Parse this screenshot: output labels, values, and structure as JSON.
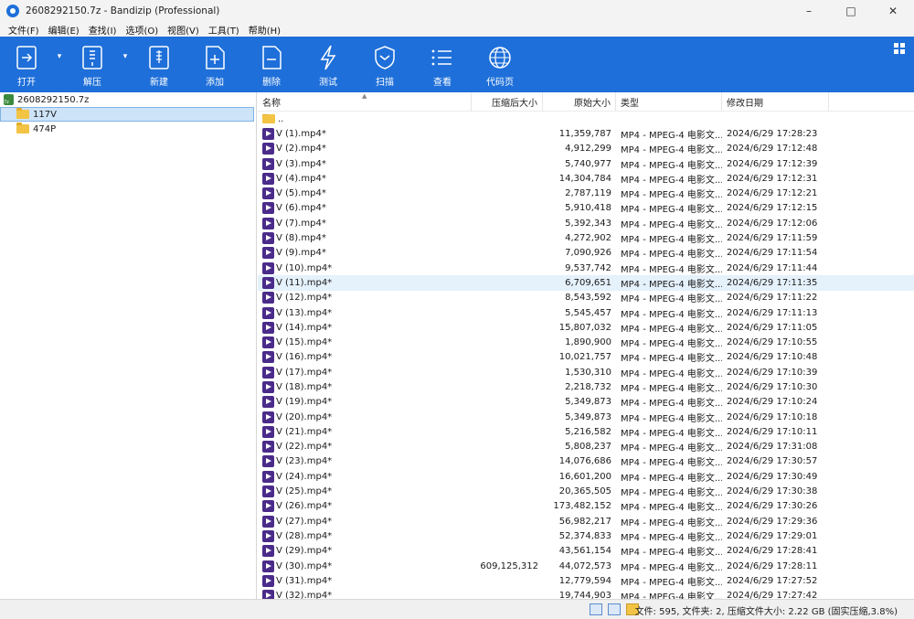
{
  "window": {
    "title": "2608292150.7z - Bandizip (Professional)"
  },
  "menu": [
    "文件(F)",
    "编辑(E)",
    "查找(I)",
    "选项(O)",
    "视图(V)",
    "工具(T)",
    "帮助(H)"
  ],
  "toolbar": {
    "open": "打开",
    "extract": "解压",
    "new": "新建",
    "add": "添加",
    "delete": "删除",
    "test": "测试",
    "scan": "扫描",
    "view": "查看",
    "codepage": "代码页"
  },
  "tree": {
    "root": "2608292150.7z",
    "folders": [
      "117V",
      "474P"
    ]
  },
  "columns": {
    "name": "名称",
    "compressed": "压缩后大小",
    "original": "原始大小",
    "type": "类型",
    "modified": "修改日期"
  },
  "parent_entry": "..",
  "files": [
    {
      "name": "V (1).mp4*",
      "compressed": "",
      "original": "11,359,787",
      "type": "MP4 - MPEG-4 电影文...",
      "modified": "2024/6/29 17:28:23"
    },
    {
      "name": "V (2).mp4*",
      "compressed": "",
      "original": "4,912,299",
      "type": "MP4 - MPEG-4 电影文...",
      "modified": "2024/6/29 17:12:48"
    },
    {
      "name": "V (3).mp4*",
      "compressed": "",
      "original": "5,740,977",
      "type": "MP4 - MPEG-4 电影文...",
      "modified": "2024/6/29 17:12:39"
    },
    {
      "name": "V (4).mp4*",
      "compressed": "",
      "original": "14,304,784",
      "type": "MP4 - MPEG-4 电影文...",
      "modified": "2024/6/29 17:12:31"
    },
    {
      "name": "V (5).mp4*",
      "compressed": "",
      "original": "2,787,119",
      "type": "MP4 - MPEG-4 电影文...",
      "modified": "2024/6/29 17:12:21"
    },
    {
      "name": "V (6).mp4*",
      "compressed": "",
      "original": "5,910,418",
      "type": "MP4 - MPEG-4 电影文...",
      "modified": "2024/6/29 17:12:15"
    },
    {
      "name": "V (7).mp4*",
      "compressed": "",
      "original": "5,392,343",
      "type": "MP4 - MPEG-4 电影文...",
      "modified": "2024/6/29 17:12:06"
    },
    {
      "name": "V (8).mp4*",
      "compressed": "",
      "original": "4,272,902",
      "type": "MP4 - MPEG-4 电影文...",
      "modified": "2024/6/29 17:11:59"
    },
    {
      "name": "V (9).mp4*",
      "compressed": "",
      "original": "7,090,926",
      "type": "MP4 - MPEG-4 电影文...",
      "modified": "2024/6/29 17:11:54"
    },
    {
      "name": "V (10).mp4*",
      "compressed": "",
      "original": "9,537,742",
      "type": "MP4 - MPEG-4 电影文...",
      "modified": "2024/6/29 17:11:44"
    },
    {
      "name": "V (11).mp4*",
      "compressed": "",
      "original": "6,709,651",
      "type": "MP4 - MPEG-4 电影文...",
      "modified": "2024/6/29 17:11:35"
    },
    {
      "name": "V (12).mp4*",
      "compressed": "",
      "original": "8,543,592",
      "type": "MP4 - MPEG-4 电影文...",
      "modified": "2024/6/29 17:11:22"
    },
    {
      "name": "V (13).mp4*",
      "compressed": "",
      "original": "5,545,457",
      "type": "MP4 - MPEG-4 电影文...",
      "modified": "2024/6/29 17:11:13"
    },
    {
      "name": "V (14).mp4*",
      "compressed": "",
      "original": "15,807,032",
      "type": "MP4 - MPEG-4 电影文...",
      "modified": "2024/6/29 17:11:05"
    },
    {
      "name": "V (15).mp4*",
      "compressed": "",
      "original": "1,890,900",
      "type": "MP4 - MPEG-4 电影文...",
      "modified": "2024/6/29 17:10:55"
    },
    {
      "name": "V (16).mp4*",
      "compressed": "",
      "original": "10,021,757",
      "type": "MP4 - MPEG-4 电影文...",
      "modified": "2024/6/29 17:10:48"
    },
    {
      "name": "V (17).mp4*",
      "compressed": "",
      "original": "1,530,310",
      "type": "MP4 - MPEG-4 电影文...",
      "modified": "2024/6/29 17:10:39"
    },
    {
      "name": "V (18).mp4*",
      "compressed": "",
      "original": "2,218,732",
      "type": "MP4 - MPEG-4 电影文...",
      "modified": "2024/6/29 17:10:30"
    },
    {
      "name": "V (19).mp4*",
      "compressed": "",
      "original": "5,349,873",
      "type": "MP4 - MPEG-4 电影文...",
      "modified": "2024/6/29 17:10:24"
    },
    {
      "name": "V (20).mp4*",
      "compressed": "",
      "original": "5,349,873",
      "type": "MP4 - MPEG-4 电影文...",
      "modified": "2024/6/29 17:10:18"
    },
    {
      "name": "V (21).mp4*",
      "compressed": "",
      "original": "5,216,582",
      "type": "MP4 - MPEG-4 电影文...",
      "modified": "2024/6/29 17:10:11"
    },
    {
      "name": "V (22).mp4*",
      "compressed": "",
      "original": "5,808,237",
      "type": "MP4 - MPEG-4 电影文...",
      "modified": "2024/6/29 17:31:08"
    },
    {
      "name": "V (23).mp4*",
      "compressed": "",
      "original": "14,076,686",
      "type": "MP4 - MPEG-4 电影文...",
      "modified": "2024/6/29 17:30:57"
    },
    {
      "name": "V (24).mp4*",
      "compressed": "",
      "original": "16,601,200",
      "type": "MP4 - MPEG-4 电影文...",
      "modified": "2024/6/29 17:30:49"
    },
    {
      "name": "V (25).mp4*",
      "compressed": "",
      "original": "20,365,505",
      "type": "MP4 - MPEG-4 电影文...",
      "modified": "2024/6/29 17:30:38"
    },
    {
      "name": "V (26).mp4*",
      "compressed": "",
      "original": "173,482,152",
      "type": "MP4 - MPEG-4 电影文...",
      "modified": "2024/6/29 17:30:26"
    },
    {
      "name": "V (27).mp4*",
      "compressed": "",
      "original": "56,982,217",
      "type": "MP4 - MPEG-4 电影文...",
      "modified": "2024/6/29 17:29:36"
    },
    {
      "name": "V (28).mp4*",
      "compressed": "",
      "original": "52,374,833",
      "type": "MP4 - MPEG-4 电影文...",
      "modified": "2024/6/29 17:29:01"
    },
    {
      "name": "V (29).mp4*",
      "compressed": "",
      "original": "43,561,154",
      "type": "MP4 - MPEG-4 电影文...",
      "modified": "2024/6/29 17:28:41"
    },
    {
      "name": "V (30).mp4*",
      "compressed": "609,125,312",
      "original": "44,072,573",
      "type": "MP4 - MPEG-4 电影文...",
      "modified": "2024/6/29 17:28:11"
    },
    {
      "name": "V (31).mp4*",
      "compressed": "",
      "original": "12,779,594",
      "type": "MP4 - MPEG-4 电影文...",
      "modified": "2024/6/29 17:27:52"
    },
    {
      "name": "V (32).mp4*",
      "compressed": "",
      "original": "19,744,903",
      "type": "MP4 - MPEG-4 电影文...",
      "modified": "2024/6/29 17:27:42"
    }
  ],
  "status": {
    "text": "文件: 595, 文件夹: 2, 压缩文件大小: 2.22 GB (固实压缩,3.8%)"
  },
  "colors": {
    "toolbar": "#1e6fd9",
    "selection": "#cde3f8",
    "hover_row": "#e5f1fb"
  }
}
